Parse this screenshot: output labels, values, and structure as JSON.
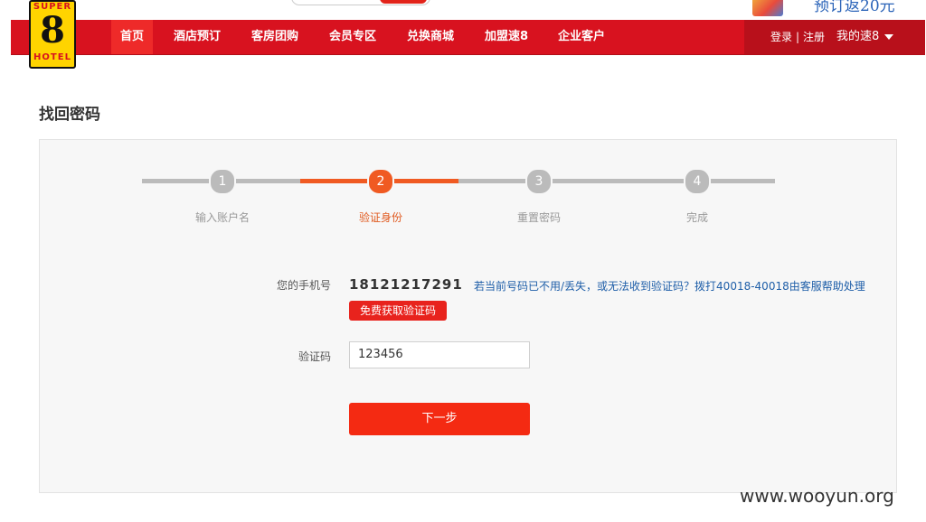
{
  "header": {
    "promo_text": "预订返20元",
    "logo": {
      "super": "SUPER",
      "eight": "8",
      "hotel": "HOTEL"
    }
  },
  "nav": {
    "items": [
      {
        "label": "首页",
        "active": true
      },
      {
        "label": "酒店预订",
        "active": false
      },
      {
        "label": "客房团购",
        "active": false
      },
      {
        "label": "会员专区",
        "active": false
      },
      {
        "label": "兑换商城",
        "active": false
      },
      {
        "label": "加盟速8",
        "active": false
      },
      {
        "label": "企业客户",
        "active": false
      }
    ],
    "login": "登录",
    "separator": "|",
    "register": "注册",
    "my_account": "我的速8"
  },
  "page": {
    "title": "找回密码"
  },
  "steps": [
    {
      "number": "1",
      "label": "输入账户名",
      "active": false
    },
    {
      "number": "2",
      "label": "验证身份",
      "active": true
    },
    {
      "number": "3",
      "label": "重置密码",
      "active": false
    },
    {
      "number": "4",
      "label": "完成",
      "active": false
    }
  ],
  "form": {
    "phone_label": "您的手机号",
    "phone_value": "18121217291",
    "help_text": "若当前号码已不用/丢失，或无法收到验证码？拨打40018-40018由客服帮助处理",
    "sms_button": "免费获取验证码",
    "code_label": "验证码",
    "code_value": "123456",
    "next_button": "下一步"
  },
  "watermark": "www.wooyun.org",
  "colors": {
    "brand_red": "#d8121f",
    "step_orange": "#f05a22",
    "button_red": "#f42a12",
    "link_blue": "#1e5ea8"
  }
}
